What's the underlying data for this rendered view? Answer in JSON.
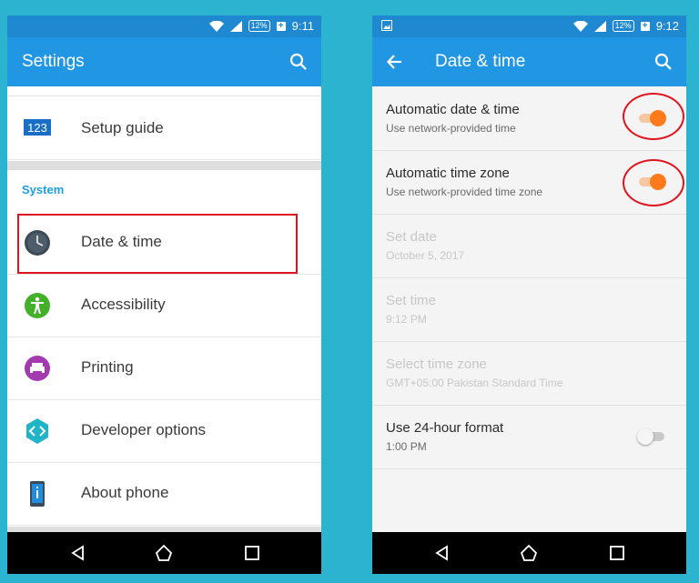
{
  "colors": {
    "background": "#2cb3d0",
    "statusbar": "#1e88d1",
    "appbar": "#2196e3",
    "accent": "#1e9ce0",
    "toggle_on": "#ff7a1a",
    "annotation": "#e0141e"
  },
  "left": {
    "status": {
      "battery": "12%",
      "time": "9:11"
    },
    "appbar": {
      "title": "Settings",
      "search_icon": "search-icon"
    },
    "items_top": [
      {
        "label": "Setup guide",
        "icon": "setup-guide-123-icon"
      }
    ],
    "section_title": "System",
    "items": [
      {
        "label": "Date & time",
        "icon": "clock-icon"
      },
      {
        "label": "Accessibility",
        "icon": "accessibility-icon"
      },
      {
        "label": "Printing",
        "icon": "printer-icon"
      },
      {
        "label": "Developer options",
        "icon": "developer-code-icon"
      },
      {
        "label": "About phone",
        "icon": "phone-info-icon"
      }
    ]
  },
  "right": {
    "status": {
      "battery": "12%",
      "time": "9:12"
    },
    "appbar": {
      "title": "Date & time",
      "back_icon": "back-arrow-icon",
      "search_icon": "search-icon"
    },
    "items": [
      {
        "title": "Automatic date & time",
        "subtitle": "Use network-provided time",
        "toggle": "on",
        "enabled": true
      },
      {
        "title": "Automatic time zone",
        "subtitle": "Use network-provided time zone",
        "toggle": "on",
        "enabled": true
      },
      {
        "title": "Set date",
        "subtitle": "October 5, 2017",
        "enabled": false
      },
      {
        "title": "Set time",
        "subtitle": "9:12 PM",
        "enabled": false
      },
      {
        "title": "Select time zone",
        "subtitle": "GMT+05:00 Pakistan Standard Time",
        "enabled": false
      },
      {
        "title": "Use 24-hour format",
        "subtitle": "1:00 PM",
        "toggle": "off",
        "enabled": true
      }
    ]
  },
  "navbar": {
    "back": "nav-back-icon",
    "home": "nav-home-icon",
    "recents": "nav-recents-icon"
  }
}
